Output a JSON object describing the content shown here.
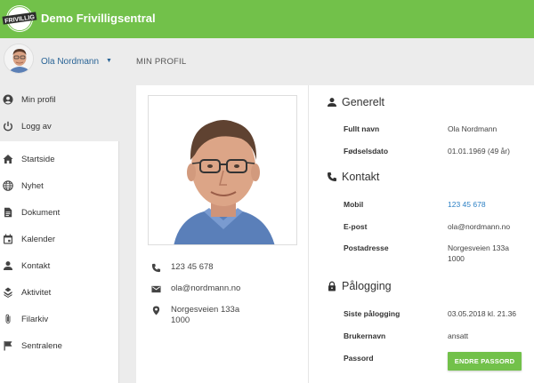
{
  "app": {
    "title": "Demo Frivilligsentral",
    "logo_text": "FRIVILLIG"
  },
  "colors": {
    "brand_green": "#72c14a",
    "link_blue": "#2a7fc4"
  },
  "user": {
    "name": "Ola Nordmann",
    "caret_icon": "caret-down-icon"
  },
  "user_menu": [
    {
      "label": "Min profil",
      "icon": "account-circle-icon"
    },
    {
      "label": "Logg av",
      "icon": "power-icon"
    }
  ],
  "nav": [
    {
      "label": "Startside",
      "icon": "home-icon"
    },
    {
      "label": "Nyhet",
      "icon": "globe-icon"
    },
    {
      "label": "Dokument",
      "icon": "document-icon"
    },
    {
      "label": "Kalender",
      "icon": "calendar-icon"
    },
    {
      "label": "Kontakt",
      "icon": "person-icon"
    },
    {
      "label": "Aktivitet",
      "icon": "activity-icon"
    },
    {
      "label": "Filarkiv",
      "icon": "paperclip-icon"
    },
    {
      "label": "Sentralene",
      "icon": "flag-icon"
    }
  ],
  "page": {
    "title": "MIN PROFIL"
  },
  "contact_card": {
    "phone": "123 45 678",
    "email": "ola@nordmann.no",
    "address_line1": "Norgesveien 133a",
    "address_line2": "1000"
  },
  "generelt": {
    "title": "Generelt",
    "full_name_label": "Fullt navn",
    "full_name": "Ola Nordmann",
    "birth_label": "Fødselsdato",
    "birth": "01.01.1969 (49 år)"
  },
  "kontakt": {
    "title": "Kontakt",
    "mobile_label": "Mobil",
    "mobile": "123 45 678",
    "email_label": "E-post",
    "email": "ola@nordmann.no",
    "address_label": "Postadresse",
    "address_line1": "Norgesveien 133a",
    "address_line2": "1000"
  },
  "palogging": {
    "title": "Pålogging",
    "last_login_label": "Siste pålogging",
    "last_login": "03.05.2018 kl. 21.36",
    "username_label": "Brukernavn",
    "username": "ansatt",
    "password_label": "Passord",
    "change_password_button": "ENDRE PASSORD"
  }
}
